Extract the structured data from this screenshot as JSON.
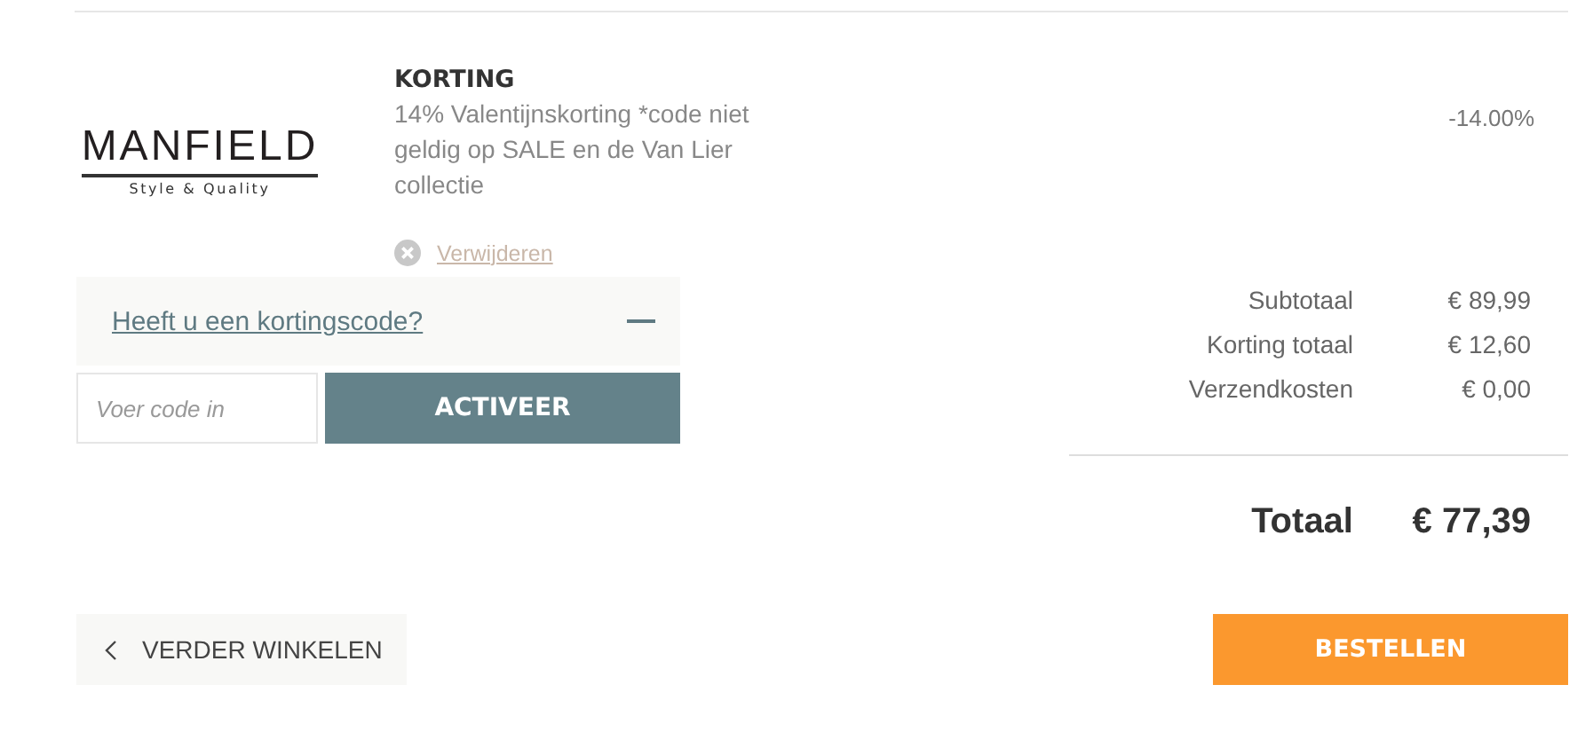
{
  "item": {
    "logo": {
      "name": "MANFIELD",
      "tagline": "Style & Quality"
    },
    "title": "KORTING",
    "description": "14% Valentijnskorting *code niet geldig op SALE en de Van Lier collectie",
    "remove_link": "Verwijderen",
    "amount": "-14.00%"
  },
  "coupon": {
    "toggle_label": "Heeft u een kortingscode?",
    "expanded": true,
    "placeholder": "Voer code in",
    "button": "ACTIVEER"
  },
  "summary": [
    {
      "label": "Subtotaal",
      "value": "€ 89,99"
    },
    {
      "label": "Korting totaal",
      "value": "€ 12,60"
    },
    {
      "label": "Verzendkosten",
      "value": "€ 0,00"
    }
  ],
  "total": {
    "label": "Totaal",
    "value": "€ 77,39"
  },
  "actions": {
    "back": "VERDER WINKELEN",
    "order": "BESTELLEN"
  }
}
